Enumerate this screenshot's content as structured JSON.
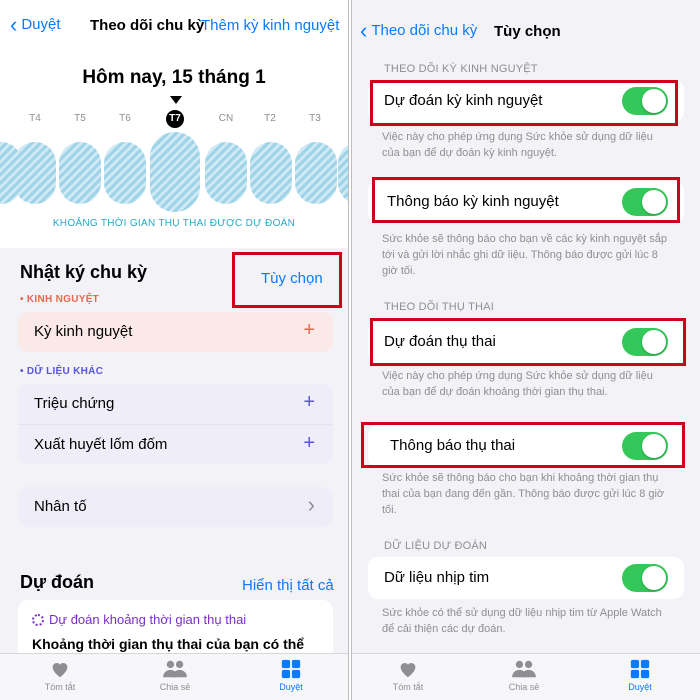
{
  "left": {
    "nav": {
      "back_label": "Duyệt",
      "title": "Theo dõi chu kỳ",
      "right_label": "Thêm kỳ kinh nguyệt"
    },
    "calendar": {
      "today_label": "Hôm nay, 15 tháng 1",
      "days": [
        "T4",
        "T5",
        "T6",
        "T7",
        "CN",
        "T2",
        "T3"
      ],
      "fertile_window_label": "KHOẢNG THỜI GIAN THỤ THAI ĐƯỢC DỰ ĐOÁN"
    },
    "log": {
      "title": "Nhật ký chu kỳ",
      "options_link": "Tùy chọn",
      "period_category": "• KINH NGUYỆT",
      "period_item": "Kỳ kinh nguyệt",
      "other_category": "• DỮ LIỆU KHÁC",
      "other_items": [
        "Triệu chứng",
        "Xuất huyết lốm đốm"
      ],
      "factors_item": "Nhân tố",
      "plus": "+",
      "chevron": "›"
    },
    "prediction": {
      "title": "Dự đoán",
      "show_all": "Hiển thị tất cả",
      "card_title": "Dự đoán khoảng thời gian thụ thai",
      "card_body": "Khoảng thời gian thụ thai của bạn có thể"
    }
  },
  "right": {
    "nav": {
      "back_label": "Theo dõi chu kỳ",
      "title": "Tùy chọn"
    },
    "sections": {
      "period_head": "THEO DÕI KỲ KINH NGUYỆT",
      "fertility_head": "THEO DÕI THỤ THAI",
      "data_head": "DỮ LIỆU DỰ ĐOÁN"
    },
    "rows": {
      "period_prediction": "Dự đoán kỳ kinh nguyệt",
      "period_prediction_desc": "Việc này cho phép ứng dụng Sức khỏe sử dụng dữ liệu của bạn để dự đoán kỳ kinh nguyệt.",
      "period_notification": "Thông báo kỳ kinh nguyệt",
      "period_notification_desc": "Sức khỏe sẽ thông báo cho bạn về các kỳ kinh nguyệt sắp tới và gửi lời nhắc ghi dữ liệu. Thông báo được gửi lúc 8 giờ tối.",
      "fertility_prediction": "Dự đoán thụ thai",
      "fertility_prediction_desc": "Việc này cho phép ứng dụng Sức khỏe sử dụng dữ liệu của bạn để dự đoán khoảng thời gian thụ thai.",
      "fertility_notification": "Thông báo thụ thai",
      "fertility_notification_desc": "Sức khỏe sẽ thông báo cho bạn khi khoảng thời gian thụ thai của bạn đang đến gần. Thông báo được gửi lúc 8 giờ tối.",
      "heart_rate": "Dữ liệu nhịp tim",
      "heart_rate_desc": "Sức khỏe có thể sử dụng dữ liệu nhịp tim từ Apple Watch để cải thiện các dự đoán."
    }
  },
  "tabs": {
    "summary": "Tóm tắt",
    "sharing": "Chia sẻ",
    "browse": "Duyệt"
  },
  "colors": {
    "accent": "#0a7aff",
    "toggle_on": "#34c759",
    "highlight": "#d0021b",
    "period": "#e8674f",
    "other": "#5856d6"
  }
}
